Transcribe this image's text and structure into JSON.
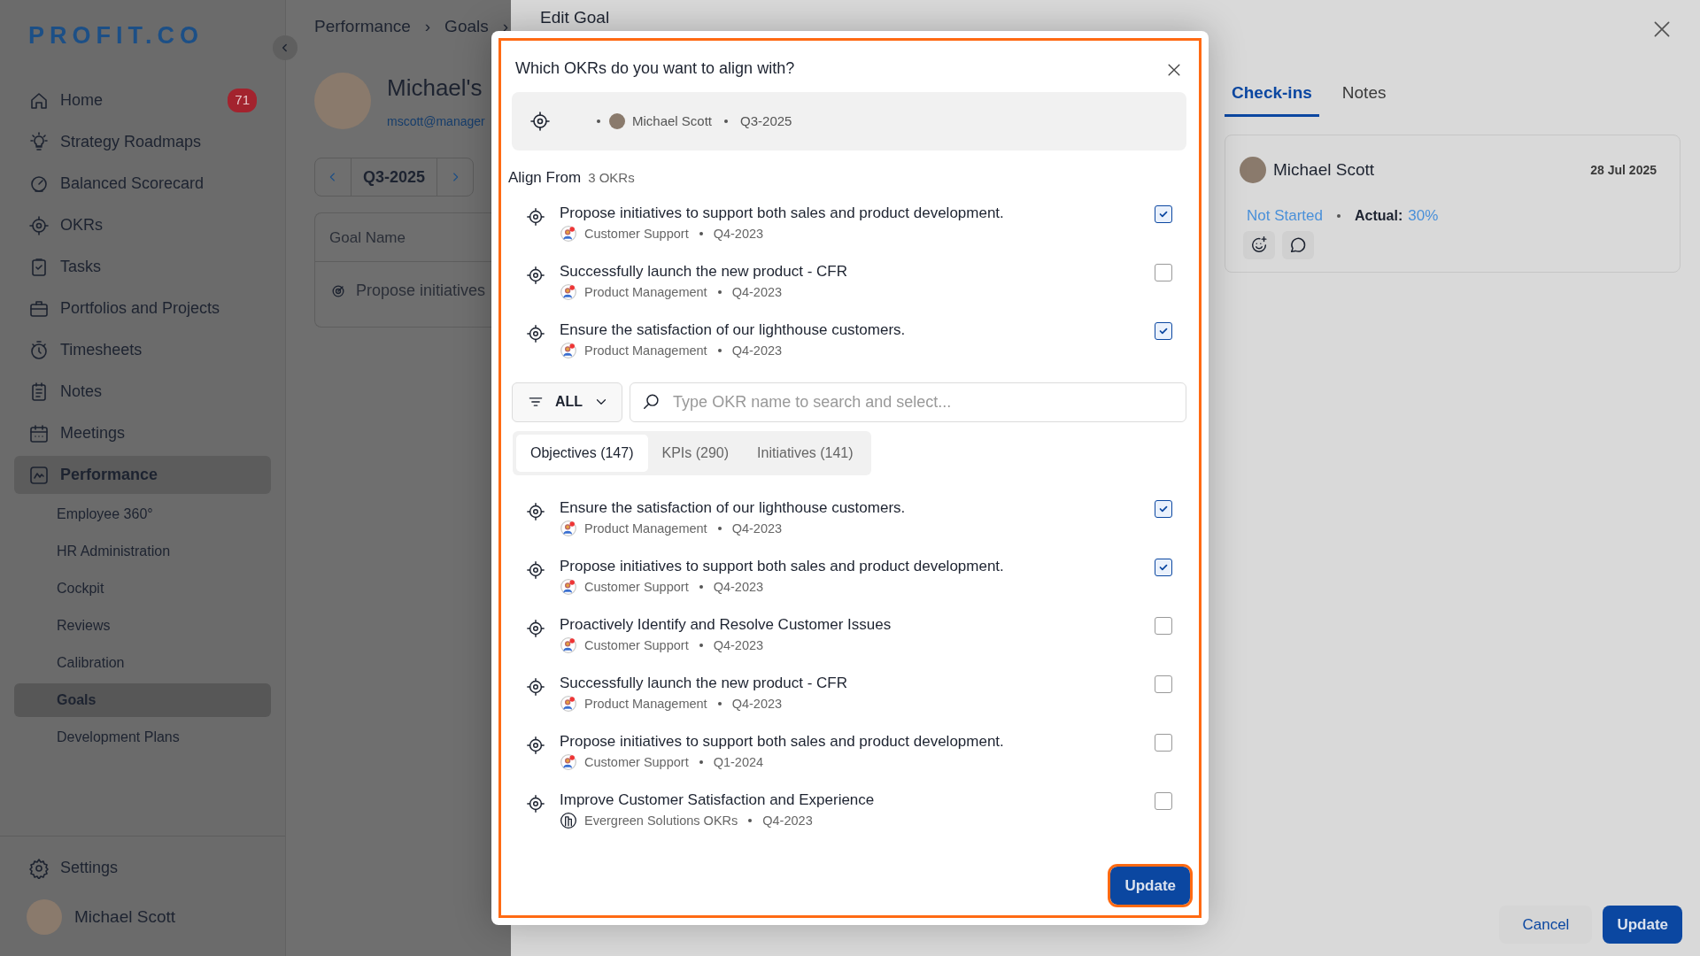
{
  "sidebar": {
    "logo": "PROFIT.CO",
    "items": [
      {
        "label": "Home",
        "badge": "71",
        "selected": false
      },
      {
        "label": "Strategy Roadmaps",
        "selected": false
      },
      {
        "label": "Balanced Scorecard",
        "selected": false
      },
      {
        "label": "OKRs",
        "selected": false
      },
      {
        "label": "Tasks",
        "selected": false
      },
      {
        "label": "Portfolios and Projects",
        "selected": false
      },
      {
        "label": "Timesheets",
        "selected": false
      },
      {
        "label": "Notes",
        "selected": false
      },
      {
        "label": "Meetings",
        "selected": false
      },
      {
        "label": "Performance",
        "selected": true,
        "children": [
          {
            "label": "Employee 360°",
            "selected": false
          },
          {
            "label": "HR Administration",
            "selected": false
          },
          {
            "label": "Cockpit",
            "selected": false
          },
          {
            "label": "Reviews",
            "selected": false
          },
          {
            "label": "Calibration",
            "selected": false
          },
          {
            "label": "Goals",
            "selected": true
          },
          {
            "label": "Development Plans",
            "selected": false
          }
        ]
      }
    ],
    "settings": "Settings",
    "user": "Michael Scott"
  },
  "main": {
    "breadcrumb": {
      "items": [
        "Performance",
        "Goals"
      ],
      "separator": "›"
    },
    "profile": {
      "name": "Michael's",
      "email": "mscott@manager"
    },
    "period": "Q3-2025",
    "table": {
      "columns": [
        "Goal Name"
      ],
      "rows": [
        [
          "Propose initiatives"
        ]
      ]
    }
  },
  "drawer": {
    "title": "Edit Goal",
    "tabs": [
      {
        "label": "Check-ins",
        "selected": true
      },
      {
        "label": "Notes",
        "selected": false
      }
    ],
    "checkin": {
      "name": "Michael Scott",
      "date": "28 Jul 2025",
      "status": "Not Started",
      "actual_label": "Actual:",
      "actual_value": "30%"
    },
    "buttons": [
      {
        "label": "Cancel",
        "kind": "secondary"
      },
      {
        "label": "Update",
        "kind": "primary"
      }
    ]
  },
  "modal": {
    "title": "Which OKRs do you want to align with?",
    "target": {
      "owner": "Michael Scott",
      "period": "Q3-2025"
    },
    "align_from": {
      "label": "Align From",
      "count": "3 OKRs",
      "items": [
        {
          "title": "Propose initiatives to support both sales and product development.",
          "owner": "Customer Support",
          "kind": "team",
          "period": "Q4-2023",
          "checked": true
        },
        {
          "title": "Successfully launch the new product - CFR",
          "owner": "Product Management",
          "kind": "team",
          "period": "Q4-2023",
          "checked": false
        },
        {
          "title": "Ensure the satisfaction of our lighthouse customers.",
          "owner": "Product Management",
          "kind": "team",
          "period": "Q4-2023",
          "checked": true
        }
      ]
    },
    "filter": {
      "label": "ALL"
    },
    "search": {
      "placeholder": "Type OKR name to search and select..."
    },
    "tabs": [
      {
        "label": "Objectives (147)",
        "selected": true
      },
      {
        "label": "KPIs (290)",
        "selected": false
      },
      {
        "label": "Initiatives (141)",
        "selected": false
      }
    ],
    "results": [
      {
        "title": "Ensure the satisfaction of our lighthouse customers.",
        "owner": "Product Management",
        "kind": "team",
        "period": "Q4-2023",
        "checked": true
      },
      {
        "title": "Propose initiatives to support both sales and product development.",
        "owner": "Customer Support",
        "kind": "team",
        "period": "Q4-2023",
        "checked": true
      },
      {
        "title": "Proactively Identify and Resolve Customer Issues",
        "owner": "Customer Support",
        "kind": "team",
        "period": "Q4-2023",
        "checked": false
      },
      {
        "title": "Successfully launch the new product - CFR",
        "owner": "Product Management",
        "kind": "team",
        "period": "Q4-2023",
        "checked": false
      },
      {
        "title": "Propose initiatives to support both sales and product development.",
        "owner": "Customer Support",
        "kind": "team",
        "period": "Q1-2024",
        "checked": false
      },
      {
        "title": "Improve Customer Satisfaction and Experience",
        "owner": "Evergreen Solutions OKRs",
        "kind": "org",
        "period": "Q4-2023",
        "checked": false
      }
    ],
    "button": "Update"
  }
}
